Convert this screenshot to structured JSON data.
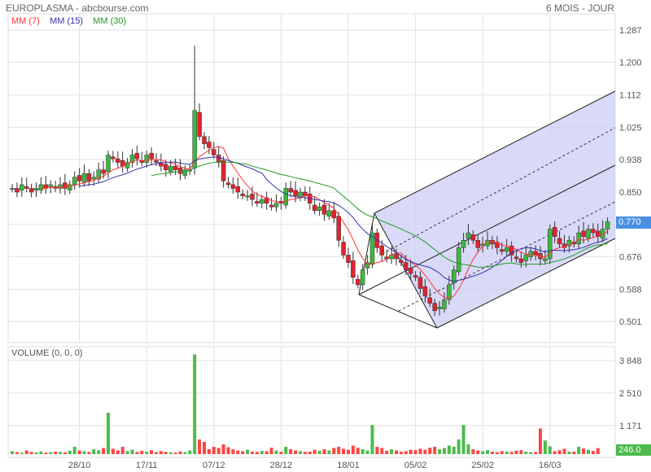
{
  "header": {
    "title": "EUROPLASMA - abcbourse.com",
    "period": "6 MOIS - JOUR"
  },
  "legend": [
    {
      "label": "MM (7)",
      "color": "#ff3333",
      "period": 7
    },
    {
      "label": "MM (15)",
      "color": "#3333aa",
      "period": 15
    },
    {
      "label": "MM (30)",
      "color": "#229922",
      "period": 30
    }
  ],
  "volume_label": "VOLUME (0, 0, 0)",
  "last_price": "0.770",
  "last_volume": "246.0",
  "chart_data": {
    "type": "candlestick",
    "price_ticks": [
      "1.287",
      "1.200",
      "1.112",
      "1.025",
      "0.938",
      "0.850",
      "0.763",
      "0.676",
      "0.588",
      "0.501"
    ],
    "price_tick_values": [
      1.287,
      1.2,
      1.112,
      1.025,
      0.938,
      0.85,
      0.763,
      0.676,
      0.588,
      0.501
    ],
    "volume_ticks": [
      "3 848",
      "2 510",
      "1 171"
    ],
    "volume_tick_values": [
      3848,
      2510,
      1171
    ],
    "x_labels": [
      {
        "label": "28/10",
        "index": 14
      },
      {
        "label": "17/11",
        "index": 28
      },
      {
        "label": "07/12",
        "index": 42
      },
      {
        "label": "28/12",
        "index": 56
      },
      {
        "label": "18/01",
        "index": 70
      },
      {
        "label": "05/02",
        "index": 84
      },
      {
        "label": "25/02",
        "index": 98
      },
      {
        "label": "16/03",
        "index": 112
      }
    ],
    "closes": [
      0.86,
      0.85,
      0.87,
      0.86,
      0.85,
      0.86,
      0.87,
      0.86,
      0.87,
      0.86,
      0.87,
      0.86,
      0.87,
      0.89,
      0.88,
      0.9,
      0.88,
      0.89,
      0.91,
      0.9,
      0.95,
      0.94,
      0.93,
      0.92,
      0.93,
      0.95,
      0.94,
      0.93,
      0.95,
      0.94,
      0.93,
      0.92,
      0.91,
      0.92,
      0.91,
      0.9,
      0.91,
      0.91,
      1.07,
      1.0,
      0.98,
      0.97,
      0.95,
      0.93,
      0.88,
      0.87,
      0.86,
      0.85,
      0.84,
      0.84,
      0.83,
      0.82,
      0.83,
      0.82,
      0.81,
      0.82,
      0.82,
      0.86,
      0.85,
      0.84,
      0.85,
      0.84,
      0.82,
      0.8,
      0.81,
      0.79,
      0.8,
      0.78,
      0.72,
      0.68,
      0.66,
      0.62,
      0.6,
      0.64,
      0.66,
      0.74,
      0.7,
      0.68,
      0.67,
      0.68,
      0.67,
      0.66,
      0.64,
      0.63,
      0.62,
      0.59,
      0.57,
      0.55,
      0.53,
      0.54,
      0.56,
      0.6,
      0.64,
      0.7,
      0.72,
      0.74,
      0.72,
      0.7,
      0.71,
      0.72,
      0.71,
      0.7,
      0.69,
      0.7,
      0.68,
      0.67,
      0.66,
      0.68,
      0.69,
      0.68,
      0.67,
      0.67,
      0.75,
      0.73,
      0.71,
      0.7,
      0.72,
      0.71,
      0.74,
      0.73,
      0.75,
      0.74,
      0.73,
      0.75,
      0.77
    ],
    "volumes": [
      120,
      80,
      60,
      150,
      90,
      70,
      110,
      60,
      80,
      100,
      90,
      70,
      140,
      300,
      150,
      120,
      90,
      200,
      160,
      250,
      1700,
      220,
      150,
      300,
      120,
      180,
      90,
      140,
      100,
      160,
      80,
      120,
      90,
      70,
      60,
      110,
      80,
      150,
      4100,
      600,
      500,
      200,
      300,
      250,
      400,
      280,
      200,
      150,
      120,
      180,
      100,
      90,
      130,
      120,
      260,
      150,
      100,
      300,
      200,
      150,
      120,
      90,
      100,
      180,
      140,
      200,
      150,
      250,
      300,
      220,
      180,
      350,
      260,
      200,
      150,
      1200,
      300,
      250,
      140,
      200,
      150,
      100,
      120,
      180,
      160,
      220,
      180,
      260,
      300,
      200,
      250,
      350,
      300,
      600,
      1200,
      400,
      200,
      150,
      120,
      160,
      100,
      80,
      120,
      110,
      90,
      140,
      160,
      100,
      80,
      90,
      1050,
      560,
      320,
      120,
      160,
      220,
      100,
      100,
      300,
      230,
      180,
      130,
      246
    ]
  }
}
